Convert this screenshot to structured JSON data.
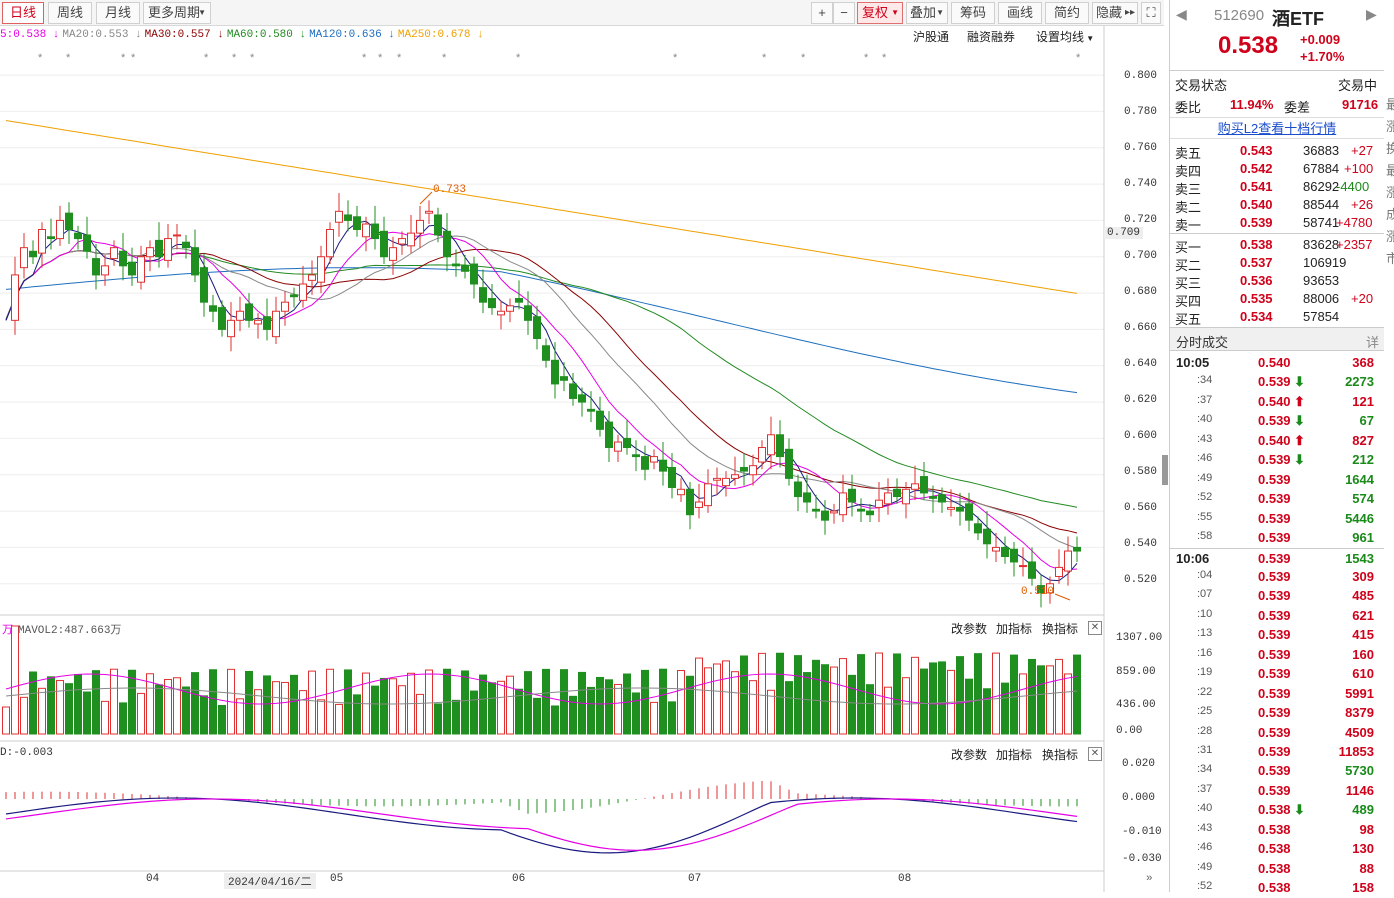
{
  "toolbar": {
    "tabs": [
      "日线",
      "周线",
      "月线",
      "更多周期"
    ],
    "zoom_in": "+",
    "zoom_out": "−",
    "adjust": "复权",
    "overlay": "叠加",
    "chips": "筹码",
    "draw": "画线",
    "simple": "简约",
    "hide": "隐藏"
  },
  "ma_legend": [
    {
      "text": "5:0.538",
      "color": "#e600e6"
    },
    {
      "text": "MA20:0.553",
      "color": "#888888"
    },
    {
      "text": "MA30:0.557",
      "color": "#8b0000"
    },
    {
      "text": "MA60:0.580",
      "color": "#228b22"
    },
    {
      "text": "MA120:0.636",
      "color": "#1e6fbf"
    },
    {
      "text": "MA250:0.678",
      "color": "#f0a000"
    }
  ],
  "top_links": [
    "沪股通",
    "融资融券",
    "设置均线"
  ],
  "price_axis": [
    "0.800",
    "0.780",
    "0.760",
    "0.740",
    "0.720",
    "0.709",
    "0.700",
    "0.680",
    "0.660",
    "0.640",
    "0.620",
    "0.600",
    "0.580",
    "0.560",
    "0.540",
    "0.520"
  ],
  "annotations": {
    "high": "0.733",
    "low": "0.510"
  },
  "vol_panel": {
    "title": "万",
    "mavol2": "MAVOL2:487.663万",
    "axis": [
      "1307.00",
      "859.00",
      "436.00",
      "0.00"
    ],
    "buttons": [
      "改参数",
      "加指标",
      "换指标"
    ]
  },
  "macd_panel": {
    "title": "D:-0.003",
    "axis": [
      "0.020",
      "0.000",
      "-0.010",
      "-0.030"
    ],
    "buttons": [
      "改参数",
      "加指标",
      "换指标"
    ]
  },
  "date_axis": {
    "labels": [
      "04",
      "05",
      "06",
      "07",
      "08"
    ],
    "cursor_date": "2024/04/16/二"
  },
  "quote": {
    "code": "512690",
    "name": "酒ETF",
    "price": "0.538",
    "change": "+0.009",
    "pct": "+1.70%"
  },
  "status": {
    "label": "交易状态",
    "value": "交易中",
    "wb_label": "委比",
    "wb_value": "11.94%",
    "wc_label": "委差",
    "wc_value": "91716",
    "l2_link": "购买L2查看十档行情"
  },
  "asks": [
    {
      "label": "卖五",
      "price": "0.543",
      "vol": "36883",
      "chg": "+27"
    },
    {
      "label": "卖四",
      "price": "0.542",
      "vol": "67884",
      "chg": "+100"
    },
    {
      "label": "卖三",
      "price": "0.541",
      "vol": "86292",
      "chg": "-4400"
    },
    {
      "label": "卖二",
      "price": "0.540",
      "vol": "88544",
      "chg": "+26"
    },
    {
      "label": "卖一",
      "price": "0.539",
      "vol": "58741",
      "chg": "+4780"
    }
  ],
  "bids": [
    {
      "label": "买一",
      "price": "0.538",
      "vol": "83628",
      "chg": "+2357"
    },
    {
      "label": "买二",
      "price": "0.537",
      "vol": "106919",
      "chg": ""
    },
    {
      "label": "买三",
      "price": "0.536",
      "vol": "93653",
      "chg": ""
    },
    {
      "label": "买四",
      "price": "0.535",
      "vol": "88006",
      "chg": "+20"
    },
    {
      "label": "买五",
      "price": "0.534",
      "vol": "57854",
      "chg": ""
    }
  ],
  "ticks_header": {
    "title": "分时成交",
    "detail": "详"
  },
  "ticks": [
    {
      "t": "10:05",
      "p": "0.540",
      "d": "",
      "v": "368",
      "vc": "r"
    },
    {
      "t": ":34",
      "p": "0.539",
      "d": "down",
      "v": "2273",
      "vc": "g"
    },
    {
      "t": ":37",
      "p": "0.540",
      "d": "up",
      "v": "121",
      "vc": "r"
    },
    {
      "t": ":40",
      "p": "0.539",
      "d": "down",
      "v": "67",
      "vc": "g"
    },
    {
      "t": ":43",
      "p": "0.540",
      "d": "up",
      "v": "827",
      "vc": "r"
    },
    {
      "t": ":46",
      "p": "0.539",
      "d": "down",
      "v": "212",
      "vc": "g"
    },
    {
      "t": ":49",
      "p": "0.539",
      "d": "",
      "v": "1644",
      "vc": "g"
    },
    {
      "t": ":52",
      "p": "0.539",
      "d": "",
      "v": "574",
      "vc": "g"
    },
    {
      "t": ":55",
      "p": "0.539",
      "d": "",
      "v": "5446",
      "vc": "g"
    },
    {
      "t": ":58",
      "p": "0.539",
      "d": "",
      "v": "961",
      "vc": "g"
    },
    {
      "t": "10:06",
      "p": "0.539",
      "d": "",
      "v": "1543",
      "vc": "g"
    },
    {
      "t": ":04",
      "p": "0.539",
      "d": "",
      "v": "309",
      "vc": "r"
    },
    {
      "t": ":07",
      "p": "0.539",
      "d": "",
      "v": "485",
      "vc": "r"
    },
    {
      "t": ":10",
      "p": "0.539",
      "d": "",
      "v": "621",
      "vc": "r"
    },
    {
      "t": ":13",
      "p": "0.539",
      "d": "",
      "v": "415",
      "vc": "r"
    },
    {
      "t": ":16",
      "p": "0.539",
      "d": "",
      "v": "160",
      "vc": "r"
    },
    {
      "t": ":19",
      "p": "0.539",
      "d": "",
      "v": "610",
      "vc": "r"
    },
    {
      "t": ":22",
      "p": "0.539",
      "d": "",
      "v": "5991",
      "vc": "r"
    },
    {
      "t": ":25",
      "p": "0.539",
      "d": "",
      "v": "8379",
      "vc": "r"
    },
    {
      "t": ":28",
      "p": "0.539",
      "d": "",
      "v": "4509",
      "vc": "r"
    },
    {
      "t": ":31",
      "p": "0.539",
      "d": "",
      "v": "11853",
      "vc": "r"
    },
    {
      "t": ":34",
      "p": "0.539",
      "d": "",
      "v": "5730",
      "vc": "g"
    },
    {
      "t": ":37",
      "p": "0.539",
      "d": "",
      "v": "1146",
      "vc": "r"
    },
    {
      "t": ":40",
      "p": "0.538",
      "d": "down",
      "v": "489",
      "vc": "g"
    },
    {
      "t": ":43",
      "p": "0.538",
      "d": "",
      "v": "98",
      "vc": "r"
    },
    {
      "t": ":46",
      "p": "0.538",
      "d": "",
      "v": "130",
      "vc": "r"
    },
    {
      "t": ":49",
      "p": "0.538",
      "d": "",
      "v": "88",
      "vc": "r"
    },
    {
      "t": ":52",
      "p": "0.538",
      "d": "",
      "v": "158",
      "vc": "r"
    }
  ],
  "side_chars": [
    "最",
    "涨",
    "换",
    "最",
    "涨",
    "成",
    "涨",
    "市"
  ]
}
